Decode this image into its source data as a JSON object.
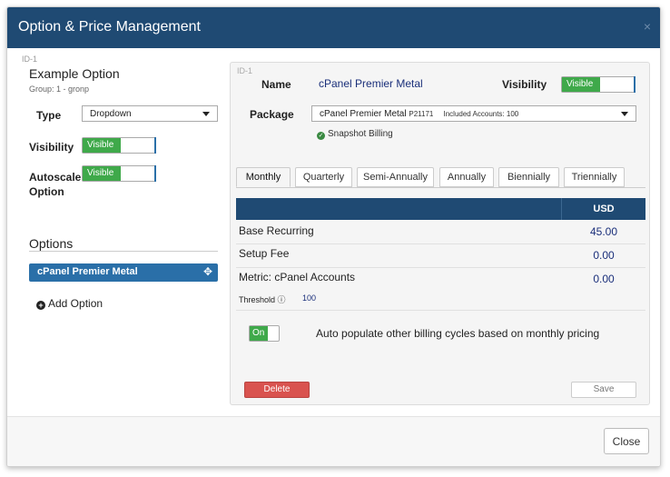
{
  "modal": {
    "title": "Option & Price Management",
    "close_x": "×",
    "close_label": "Close"
  },
  "left": {
    "id": "ID-1",
    "option_name": "Example Option",
    "group": "Group: 1 - gronp",
    "type_label": "Type",
    "type_value": "Dropdown",
    "visibility_label": "Visibility",
    "visibility_value": "Visible",
    "autoscale_label": "Autoscale Option",
    "autoscale_value": "Visible",
    "options_heading": "Options",
    "options": [
      {
        "label": "cPanel Premier Metal"
      }
    ],
    "add_option": "Add Option"
  },
  "detail": {
    "id": "ID-1",
    "name_label": "Name",
    "name_value": "cPanel Premier Metal",
    "visibility_label": "Visibility",
    "visibility_value": "Visible",
    "package_label": "Package",
    "package_name": "cPanel Premier Metal",
    "package_code": "P21171",
    "package_accounts": "Included Accounts: 100",
    "snapshot": "Snapshot Billing",
    "tabs": [
      "Monthly",
      "Quarterly",
      "Semi-Annually",
      "Annually",
      "Biennially",
      "Triennially"
    ],
    "active_tab": "Monthly",
    "currency": "USD",
    "rows": [
      {
        "label": "Base Recurring",
        "value": "45.00"
      },
      {
        "label": "Setup Fee",
        "value": "0.00"
      },
      {
        "label": "Metric: cPanel Accounts",
        "value": "0.00"
      }
    ],
    "threshold_label": "Threshold",
    "threshold_icon": "ⓘ",
    "threshold_value": "100",
    "auto_toggle": "On",
    "auto_text": "Auto populate other billing cycles based on monthly pricing",
    "delete_label": "Delete",
    "save_label": "Save"
  },
  "colors": {
    "header": "#1f4a73",
    "accent": "#2a6fa8",
    "success": "#3fa94a",
    "danger": "#d9534f"
  }
}
